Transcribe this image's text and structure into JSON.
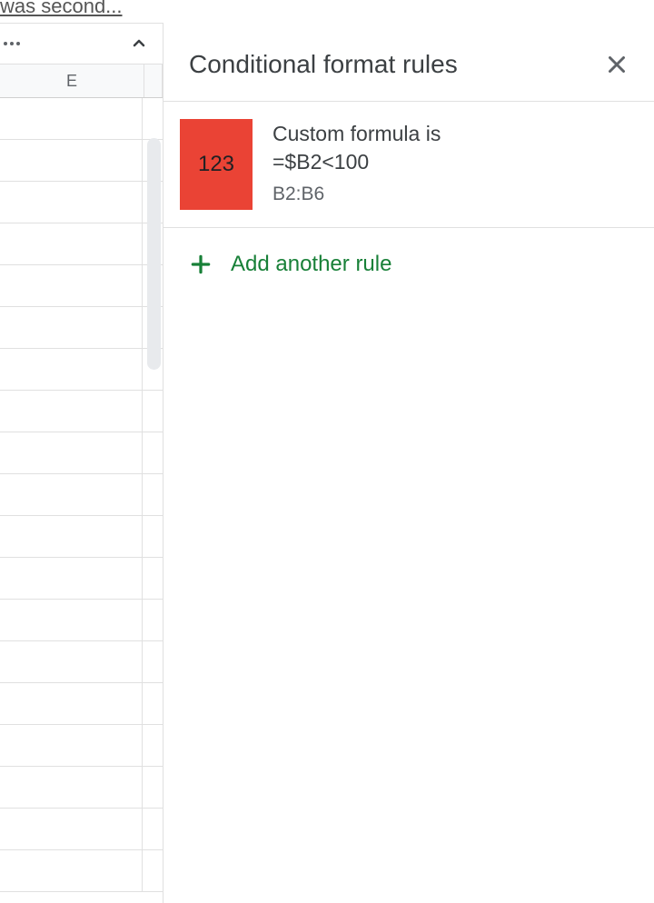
{
  "top_fragment": "  was second...",
  "sheet": {
    "column_letter": "E"
  },
  "panel": {
    "title": "Conditional format rules",
    "rules": [
      {
        "swatch_color": "#ea4335",
        "swatch_text": "123",
        "condition_label": "Custom formula is",
        "formula": "=$B2<100",
        "range": "B2:B6"
      }
    ],
    "add_rule_label": "Add another rule"
  }
}
